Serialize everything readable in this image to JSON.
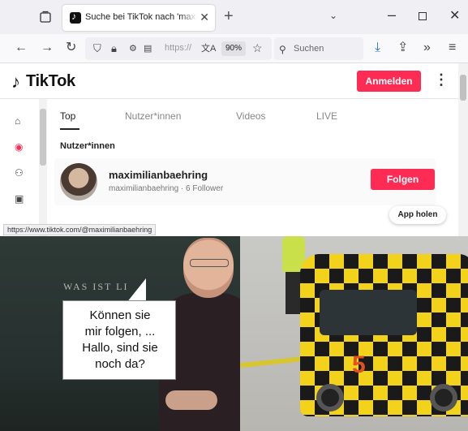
{
  "browser": {
    "tab_title": "Suche bei TikTok nach 'maximili",
    "url_placeholder": "https://",
    "zoom": "90%",
    "search_placeholder": "Suchen",
    "status_url": "https://www.tiktok.com/@maximilianbaehring"
  },
  "tiktok": {
    "logo_text": "TikTok",
    "login_label": "Anmelden",
    "tabs": [
      "Top",
      "Nutzer*innen",
      "Videos",
      "LIVE"
    ],
    "section_title": "Nutzer*innen",
    "user": {
      "username": "maximilianbaehring",
      "handle": "maximilianbaehring",
      "followers": "6 Follower"
    },
    "follow_label": "Folgen",
    "app_label": "App holen"
  },
  "meme": {
    "board_text": "WAS IST LI",
    "bubble_lines": [
      "Können sie",
      "mir folgen, ...",
      "Hallo, sind sie",
      "noch da?"
    ],
    "van_number": "5"
  }
}
